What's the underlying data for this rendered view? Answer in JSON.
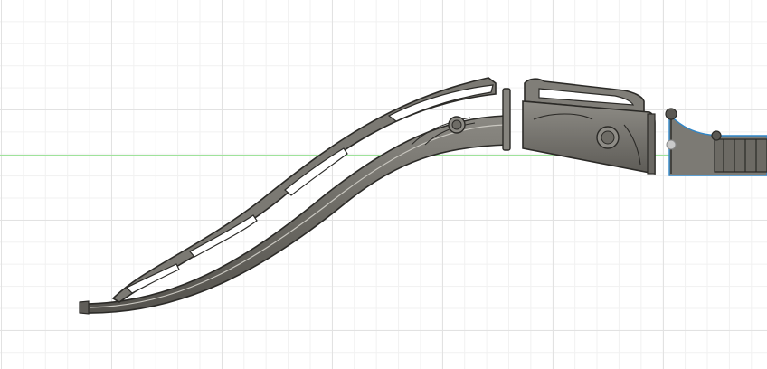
{
  "viewport": {
    "background": "#ffffff",
    "grid_major_color": "#e2e2e2",
    "grid_minor_color": "#f1f1f1",
    "x_axis_color": "#9fe39b"
  },
  "model": {
    "body_color": "#77756f",
    "edge_color": "#2b2a27",
    "highlight_color": "#c9c7c0",
    "selection_color": "#2f86c8",
    "parts": [
      {
        "name": "bow-lower-limb",
        "type": "body"
      },
      {
        "name": "limb-connector-block",
        "type": "body"
      },
      {
        "name": "riser-handle",
        "type": "body",
        "selected": true
      }
    ]
  }
}
